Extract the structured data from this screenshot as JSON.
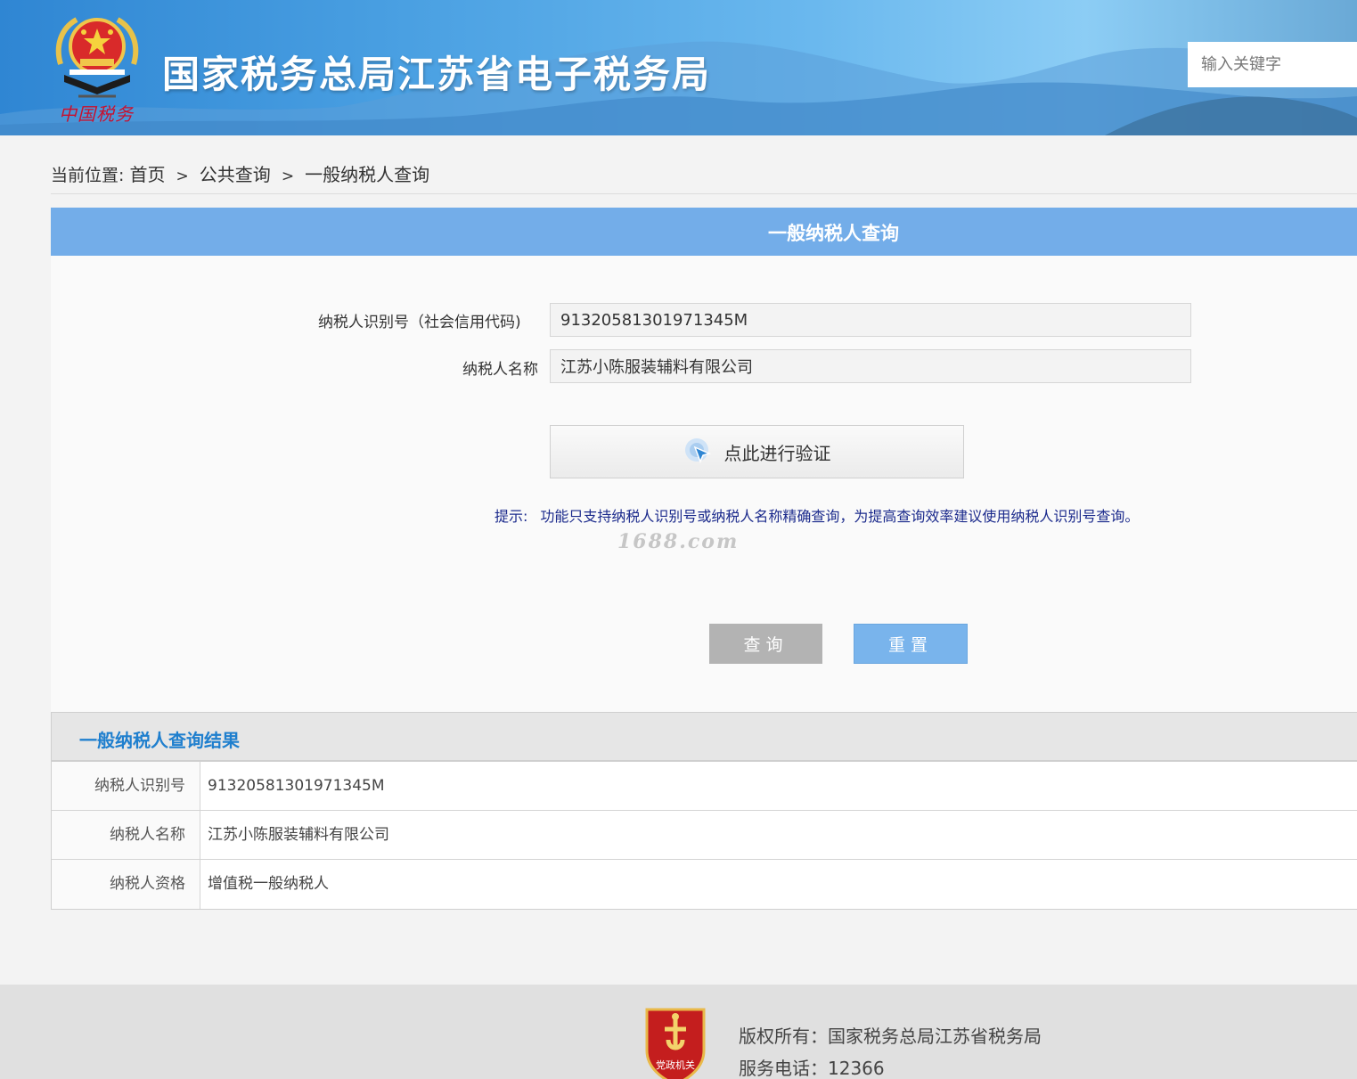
{
  "header": {
    "site_title": "国家税务总局江苏省电子税务局",
    "logo_script": "中国税务",
    "search_placeholder": "输入关键字"
  },
  "breadcrumb": {
    "prefix": "当前位置:",
    "items": [
      "首页",
      "公共查询",
      "一般纳税人查询"
    ],
    "separator": ">"
  },
  "query_panel": {
    "title": "一般纳税人查询",
    "fields": [
      {
        "label": "纳税人识别号（社会信用代码)",
        "value": "91320581301971345M"
      },
      {
        "label": "纳税人名称",
        "value": "江苏小陈服装辅料有限公司"
      }
    ],
    "verify_label": "点此进行验证",
    "tip_head": "提示:",
    "tip_text": "功能只支持纳税人识别号或纳税人名称精确查询，为提高查询效率建议使用纳税人识别号查询。",
    "watermark": "1688.com",
    "query_button": "查询",
    "reset_button": "重置"
  },
  "result": {
    "title": "一般纳税人查询结果",
    "rows": [
      {
        "key": "纳税人识别号",
        "value": "91320581301971345M"
      },
      {
        "key": "纳税人名称",
        "value": "江苏小陈服装辅料有限公司"
      },
      {
        "key": "纳税人资格",
        "value": "增值税一般纳税人"
      }
    ]
  },
  "footer": {
    "copyright": "版权所有：国家税务总局江苏省税务局",
    "phone": "服务电话：12366",
    "badge_text": "党政机关"
  },
  "colors": {
    "panel_header": "#73ade9",
    "result_title": "#1f7fce",
    "tip_text": "#1b2a8c",
    "query_button": "#b3b3b3",
    "reset_button": "#79b4ec"
  },
  "icons": {
    "emblem": "national-tax-emblem-icon",
    "verify": "cursor-pointer-icon",
    "badge": "party-government-badge-icon"
  }
}
